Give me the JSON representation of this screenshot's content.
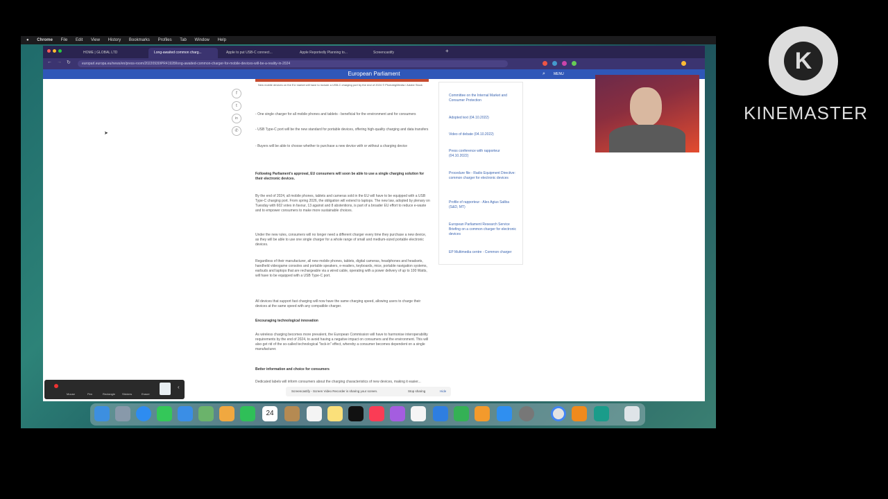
{
  "menubar": {
    "apple": "",
    "items": [
      "Chrome",
      "File",
      "Edit",
      "View",
      "History",
      "Bookmarks",
      "Profiles",
      "Tab",
      "Window",
      "Help"
    ]
  },
  "browser": {
    "tabs": [
      {
        "label": "HOME | GLOBAL LTD"
      },
      {
        "label": "Long-awaited common charg..."
      },
      {
        "label": "Apple to put USB-C connect..."
      },
      {
        "label": "Apple Reportedly Planning to..."
      },
      {
        "label": "Screencastify"
      }
    ],
    "url": "europarl.europa.eu/news/en/press-room/20220930IPR41928/long-awaited-common-charger-for-mobile-devices-will-be-a-reality-in-2024",
    "site_title": "European Parliament",
    "menu_label": "MENU"
  },
  "article": {
    "caption": "New mobile devices on the EU market will have to include a USB-C charging port by the end of 2024 © Photobig/Media / Adobe Stock",
    "bullets": [
      "One single charger for all mobile phones and tablets - beneficial for the environment and for consumers",
      "USB Type-C port will be the new standard for portable devices, offering high-quality charging and data transfers",
      "Buyers will be able to choose whether to purchase a new device with or without a charging device"
    ],
    "lead": "Following Parliament's approval, EU consumers will soon be able to use a single charging solution for their electronic devices.",
    "paragraphs": [
      "By the end of 2024, all mobile phones, tablets and cameras sold in the EU will have to be equipped with a USB Type-C charging port. From spring 2026, the obligation will extend to laptops. The new law, adopted by plenary on Tuesday with 602 votes in favour, 13 against and 8 abstentions, is part of a broader EU effort to reduce e-waste and to empower consumers to make more sustainable choices.",
      "Under the new rules, consumers will no longer need a different charger every time they purchase a new device, as they will be able to use one single charger for a whole range of small and medium-sized portable electronic devices.",
      "Regardless of their manufacturer, all new mobile phones, tablets, digital cameras, headphones and headsets, handheld videogame consoles and portable speakers, e-readers, keyboards, mice, portable navigation systems, earbuds and laptops that are rechargeable via a wired cable, operating with a power delivery of up to 100 Watts, will have to be equipped with a USB Type-C port.",
      "All devices that support fast charging will now have the same charging speed, allowing users to charge their devices at the same speed with any compatible charger."
    ],
    "subhead1": "Encouraging technological innovation",
    "para5": "As wireless charging becomes more prevalent, the European Commission will have to harmonise interoperability requirements by the end of 2024, to avoid having a negative impact on consumers and the environment. This will also get rid of the so-called technological \"lock-in\" effect, whereby a consumer becomes dependent on a single manufacturer.",
    "subhead2": "Better information and choice for consumers",
    "para6": "Dedicated labels will inform consumers about the charging characteristics of new devices, making it easier..."
  },
  "sidebar_links": [
    "Committee on the Internal Market and Consumer Protection",
    "Adopted text (04.10.2022)",
    "Video of debate (04.10.2022)",
    "Press conference with rapporteur (04.10.2022)",
    "Procedure file - Radio Equipment Directive: common charger for electronic devices",
    "Profile of rapporteur - Alex Agius Saliba (S&D, MT)",
    "European Parliament Research Service Briefing on a common charger for electronic devices",
    "EP Multimedia centre - Common charger"
  ],
  "toolbar": {
    "items": [
      "Mouse",
      "Pen",
      "Rectangle",
      "Stickers",
      "Eraser"
    ]
  },
  "sharebar": {
    "message": "Screencastify - Screen Video Recorder is sharing your screen.",
    "stop": "Stop sharing",
    "hide": "Hide"
  },
  "dock": {
    "date_day": "24"
  },
  "watermark": "KINEMASTER",
  "colors": {
    "ep_blue": "#2f57b8",
    "tab_purple": "#2a2450",
    "link_blue": "#3a64b0"
  },
  "icons": [
    "facebook-icon",
    "twitter-icon",
    "linkedin-icon",
    "whatsapp-icon",
    "search-icon",
    "menu-icon"
  ]
}
